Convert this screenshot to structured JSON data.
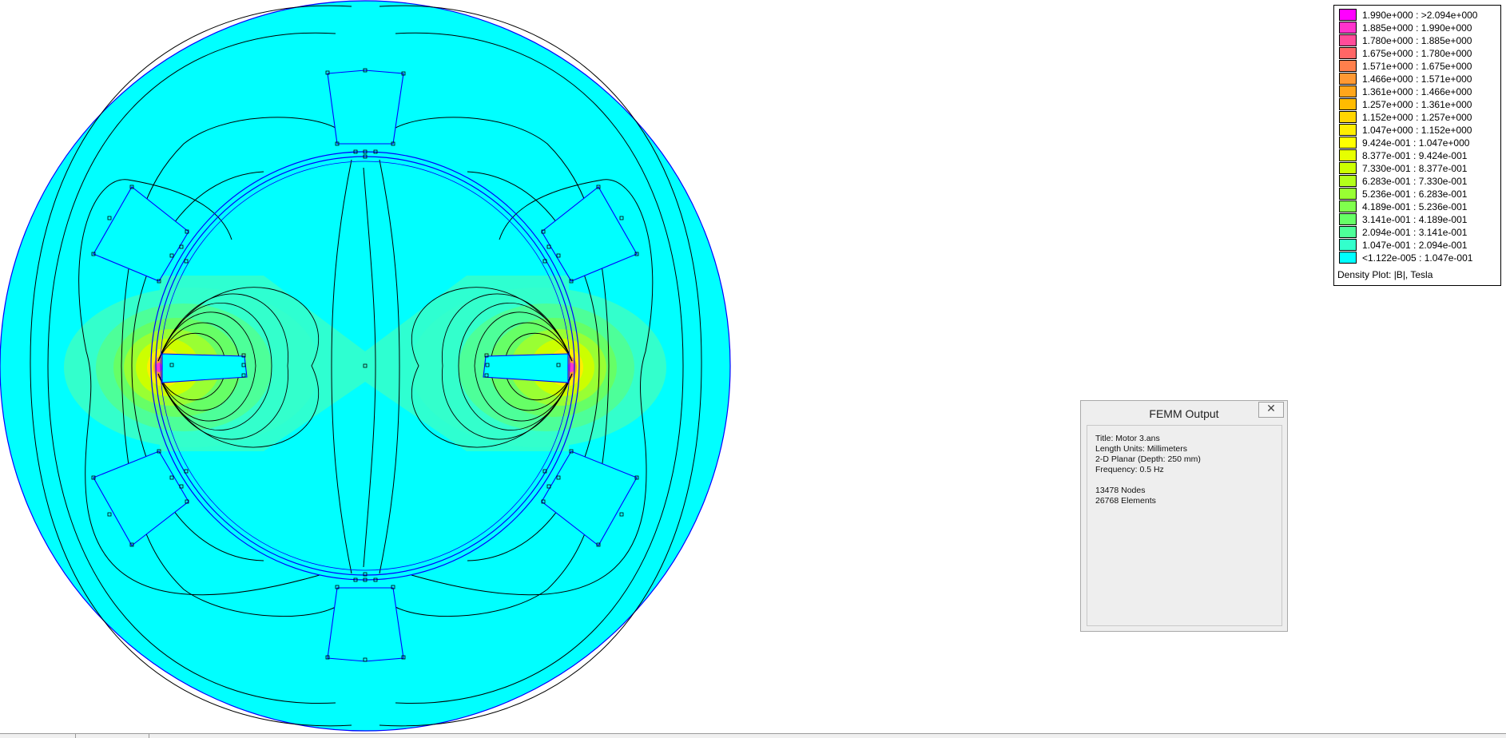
{
  "colors": {
    "background_field": "#00ffff",
    "outline": "#0000ff",
    "contour": "#000000",
    "low_flux": "#33ffcc"
  },
  "legend": {
    "title": "Density Plot: |B|, Tesla",
    "entries": [
      {
        "label": "1.990e+000 : >2.094e+000",
        "color": "#ff00ff"
      },
      {
        "label": "1.885e+000 : 1.990e+000",
        "color": "#ff33cc"
      },
      {
        "label": "1.780e+000 : 1.885e+000",
        "color": "#ff4c99"
      },
      {
        "label": "1.675e+000 : 1.780e+000",
        "color": "#ff6666"
      },
      {
        "label": "1.571e+000 : 1.675e+000",
        "color": "#ff7f4c"
      },
      {
        "label": "1.466e+000 : 1.571e+000",
        "color": "#ff9933"
      },
      {
        "label": "1.361e+000 : 1.466e+000",
        "color": "#ffa61a"
      },
      {
        "label": "1.257e+000 : 1.361e+000",
        "color": "#ffbb00"
      },
      {
        "label": "1.152e+000 : 1.257e+000",
        "color": "#ffd500"
      },
      {
        "label": "1.047e+000 : 1.152e+000",
        "color": "#ffee00"
      },
      {
        "label": "9.424e-001 : 1.047e+000",
        "color": "#ffff00"
      },
      {
        "label": "8.377e-001 : 9.424e-001",
        "color": "#e6ff00"
      },
      {
        "label": "7.330e-001 : 8.377e-001",
        "color": "#ccff00"
      },
      {
        "label": "6.283e-001 : 7.330e-001",
        "color": "#b3ff1a"
      },
      {
        "label": "5.236e-001 : 6.283e-001",
        "color": "#99ff33"
      },
      {
        "label": "4.189e-001 : 5.236e-001",
        "color": "#80ff4d"
      },
      {
        "label": "3.141e-001 : 4.189e-001",
        "color": "#66ff66"
      },
      {
        "label": "2.094e-001 : 3.141e-001",
        "color": "#4dff99"
      },
      {
        "label": "1.047e-001 : 2.094e-001",
        "color": "#33ffcc"
      },
      {
        "label": "<1.122e-005 : 1.047e-001",
        "color": "#00ffff"
      }
    ]
  },
  "output_window": {
    "title": "FEMM Output",
    "close_glyph": "✕",
    "lines": [
      "Title: Motor 3.ans",
      "Length Units: Millimeters",
      "2-D Planar (Depth: 250 mm)",
      "Frequency: 0.5 Hz",
      "",
      "13478 Nodes",
      "26768 Elements"
    ]
  }
}
